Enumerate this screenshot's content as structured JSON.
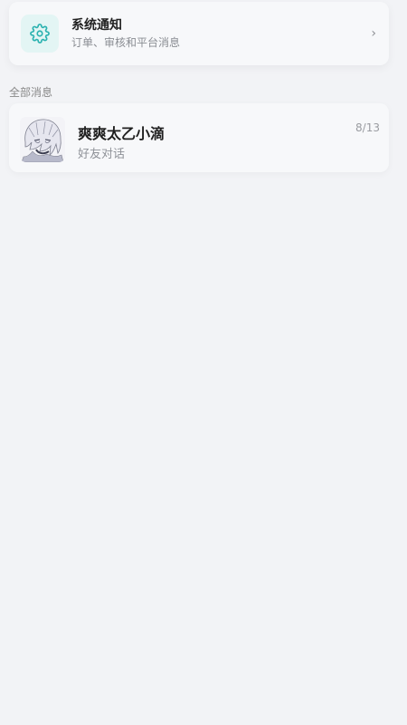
{
  "system_notice": {
    "title": "系统通知",
    "subtitle": "订单、审核和平台消息",
    "icon": "gear-icon",
    "chevron": "›"
  },
  "section": {
    "label": "全部消息"
  },
  "conversations": [
    {
      "name": "爽爽太乙小滴",
      "subtitle": "好友对话",
      "date": "8/13",
      "avatar": "anime-portrait-avatar"
    }
  ],
  "colors": {
    "background": "#f2f3f6",
    "card": "#f7f8fa",
    "accent": "#2bb2b0",
    "icon_bg": "#e3f5f4"
  }
}
